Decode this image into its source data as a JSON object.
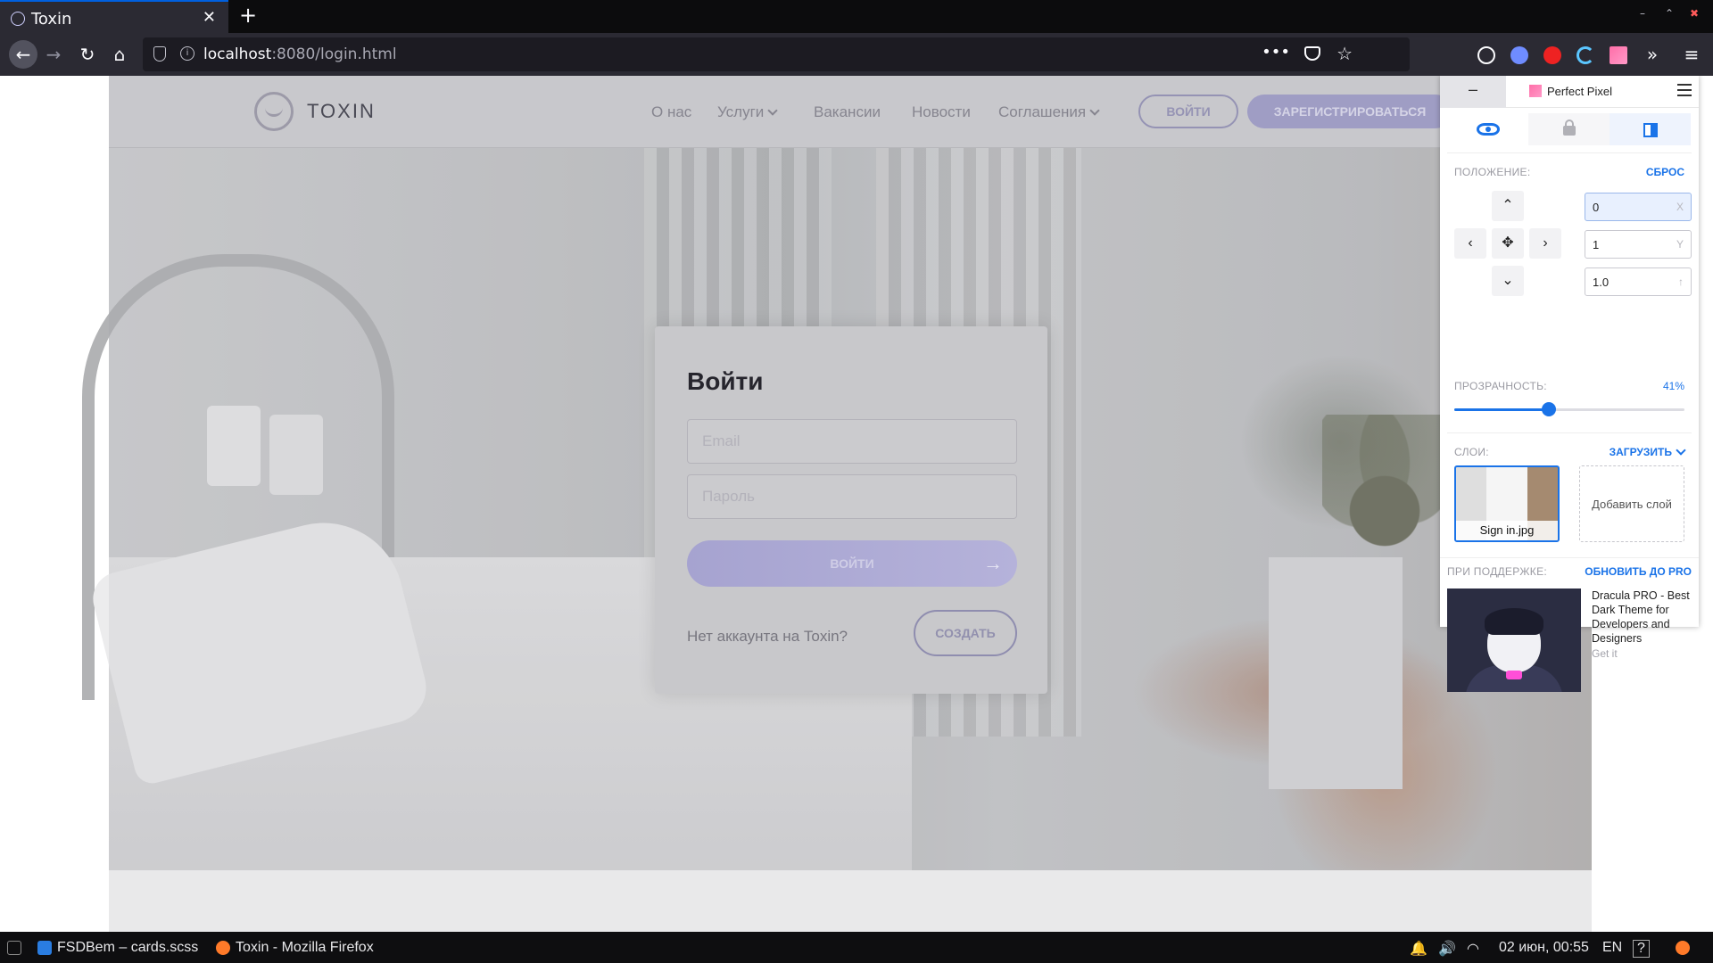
{
  "browser": {
    "tab_title": "Toxin",
    "url_host": "localhost",
    "url_rest": ":8080/login.html",
    "url_dots": "•••"
  },
  "site": {
    "logo_text": "TOXIN",
    "nav": [
      "О нас",
      "Услуги",
      "Вакансии",
      "Новости",
      "Соглашения"
    ],
    "login_button": "ВОЙТИ",
    "register_button": "ЗАРЕГИСТРИРОВАТЬСЯ"
  },
  "login_card": {
    "title": "Войти",
    "email_placeholder": "Email",
    "password_placeholder": "Пароль",
    "submit_label": "ВОЙТИ",
    "no_account_text": "Нет аккаунта на Toxin?",
    "create_label": "СОЗДАТЬ"
  },
  "perfect_pixel": {
    "minimize": "–",
    "title": "Perfect Pixel",
    "position_label": "ПОЛОЖЕНИЕ:",
    "reset_label": "СБРОС",
    "x_value": "0",
    "x_unit": "X",
    "y_value": "1",
    "y_unit": "Y",
    "scale_value": "1.0",
    "scale_unit": "↑",
    "opacity_label": "ПРОЗРАЧНОСТЬ:",
    "opacity_value": "41%",
    "opacity_fraction": 0.41,
    "layers_label": "СЛОИ:",
    "upload_label": "ЗАГРУЗИТЬ",
    "layer_name": "Sign in.jpg",
    "add_layer_label": "Добавить слой",
    "support_label": "ПРИ ПОДДЕРЖКЕ:",
    "upgrade_label": "ОБНОВИТЬ ДО PRO",
    "ad_text": "Dracula PRO - Best Dark Theme for Developers and Designers",
    "ad_cta": "Get it"
  },
  "taskbar": {
    "item1": "FSDBem – cards.scss",
    "item2": "Toxin - Mozilla Firefox",
    "clock": "02 июн, 00:55",
    "lang": "EN",
    "help": "?"
  },
  "colors": {
    "accent": "#1a73e8",
    "brand_purple": "#bc9cff"
  }
}
